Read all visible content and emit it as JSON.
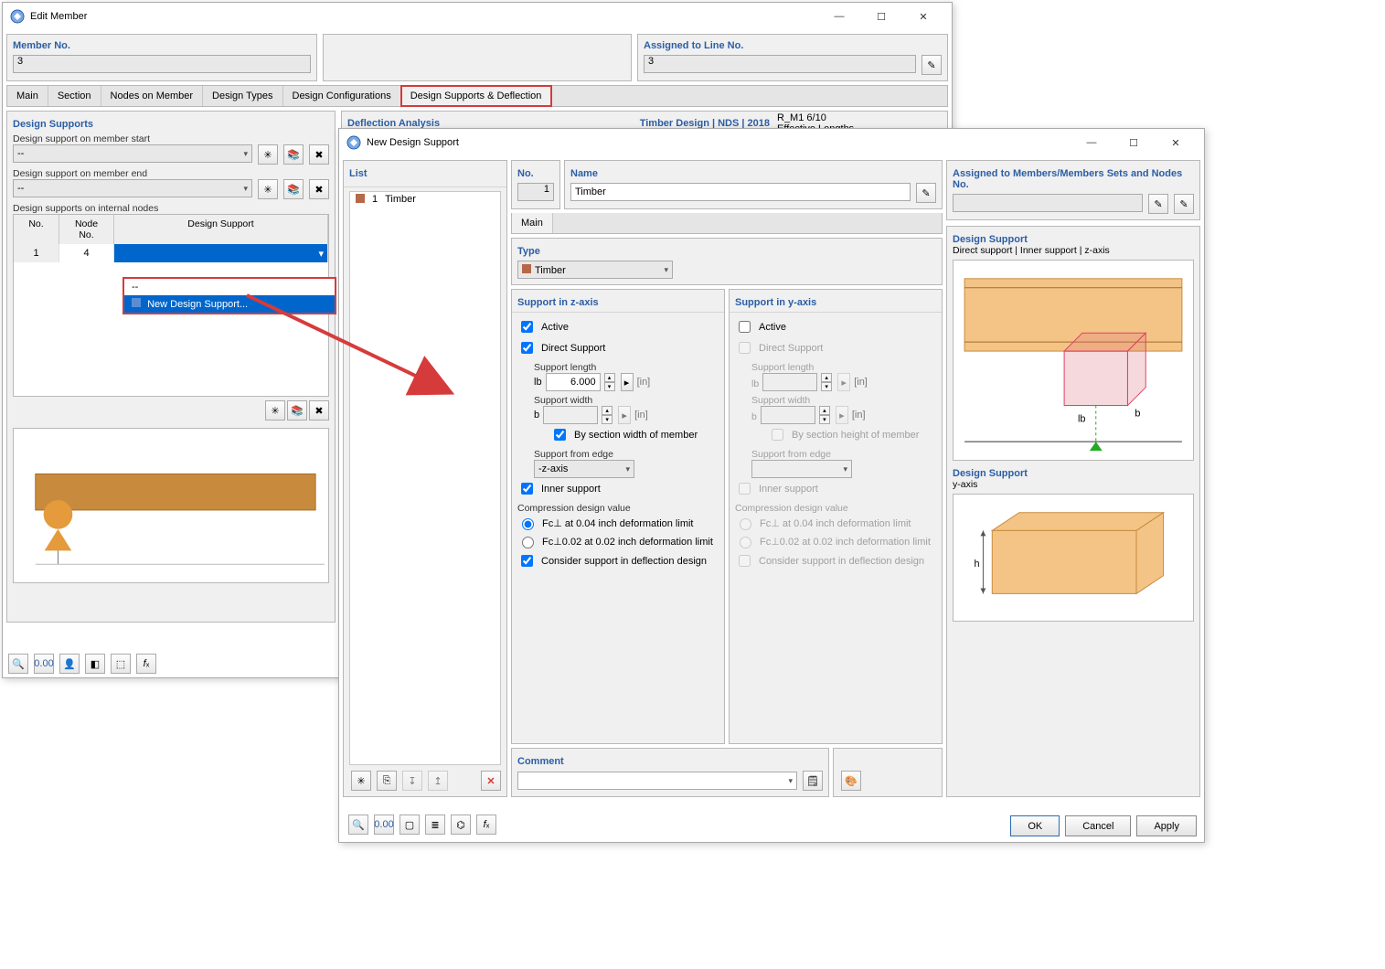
{
  "editMember": {
    "title": "Edit Member",
    "memberNoLabel": "Member No.",
    "memberNo": "3",
    "assignedLabel": "Assigned to Line No.",
    "assignedNo": "3",
    "tabs": [
      "Main",
      "Section",
      "Nodes on Member",
      "Design Types",
      "Design Configurations",
      "Design Supports & Deflection"
    ],
    "designSupports": {
      "heading": "Design Supports",
      "startLabel": "Design support on member start",
      "endLabel": "Design support on member end",
      "internalLabel": "Design supports on internal nodes",
      "emptySel": "--",
      "tblCols": {
        "no": "No.",
        "node": "Node\nNo.",
        "ds": "Design Support"
      },
      "row": {
        "no": "1",
        "node": "4"
      },
      "popOpts": [
        "--",
        "New Design Support..."
      ]
    },
    "deflection": {
      "heading": "Deflection Analysis"
    },
    "timberBadge": "Timber Design | NDS | 2018",
    "effLen": {
      "a": "R_M1 6/10",
      "b": "Effective Lengths"
    }
  },
  "newDS": {
    "title": "New Design Support",
    "list": {
      "heading": "List",
      "items": [
        {
          "n": "1",
          "name": "Timber"
        }
      ]
    },
    "noLabel": "No.",
    "no": "1",
    "nameLabel": "Name",
    "name": "Timber",
    "assignedLabel": "Assigned to Members/Members Sets and Nodes No.",
    "mainTab": "Main",
    "typeLabel": "Type",
    "typeVal": "Timber",
    "z": {
      "heading": "Support in z-axis",
      "active": "Active",
      "direct": "Direct Support",
      "lenLabel": "Support length",
      "lenSym": "lb",
      "lenVal": "6.000",
      "unit": "[in]",
      "widLabel": "Support width",
      "widSym": "b",
      "widUnit": "[in]",
      "bySection": "By section width of member",
      "fromEdge": "Support from edge",
      "fromEdgeVal": "-z-axis",
      "inner": "Inner support",
      "cdv": "Compression design value",
      "r1": "Fc⊥ at 0.04 inch deformation limit",
      "r2": "Fc⊥0.02 at 0.02 inch deformation limit",
      "consider": "Consider support in deflection design"
    },
    "y": {
      "heading": "Support in y-axis",
      "active": "Active",
      "direct": "Direct Support",
      "lenLabel": "Support length",
      "lenSym": "lb",
      "unit": "[in]",
      "widLabel": "Support width",
      "widSym": "b",
      "widUnit": "[in]",
      "bySection": "By section height of member",
      "fromEdge": "Support from edge",
      "inner": "Inner support",
      "cdv": "Compression design value",
      "r1": "Fc⊥ at 0.04 inch deformation limit",
      "r2": "Fc⊥0.02 at 0.02 inch deformation limit",
      "consider": "Consider support in deflection design"
    },
    "preview": {
      "h1": "Design Support",
      "h1b": "Direct support | Inner support | z-axis",
      "h2": "Design Support",
      "h2b": "y-axis"
    },
    "commentLabel": "Comment",
    "btns": {
      "ok": "OK",
      "cancel": "Cancel",
      "apply": "Apply"
    }
  }
}
